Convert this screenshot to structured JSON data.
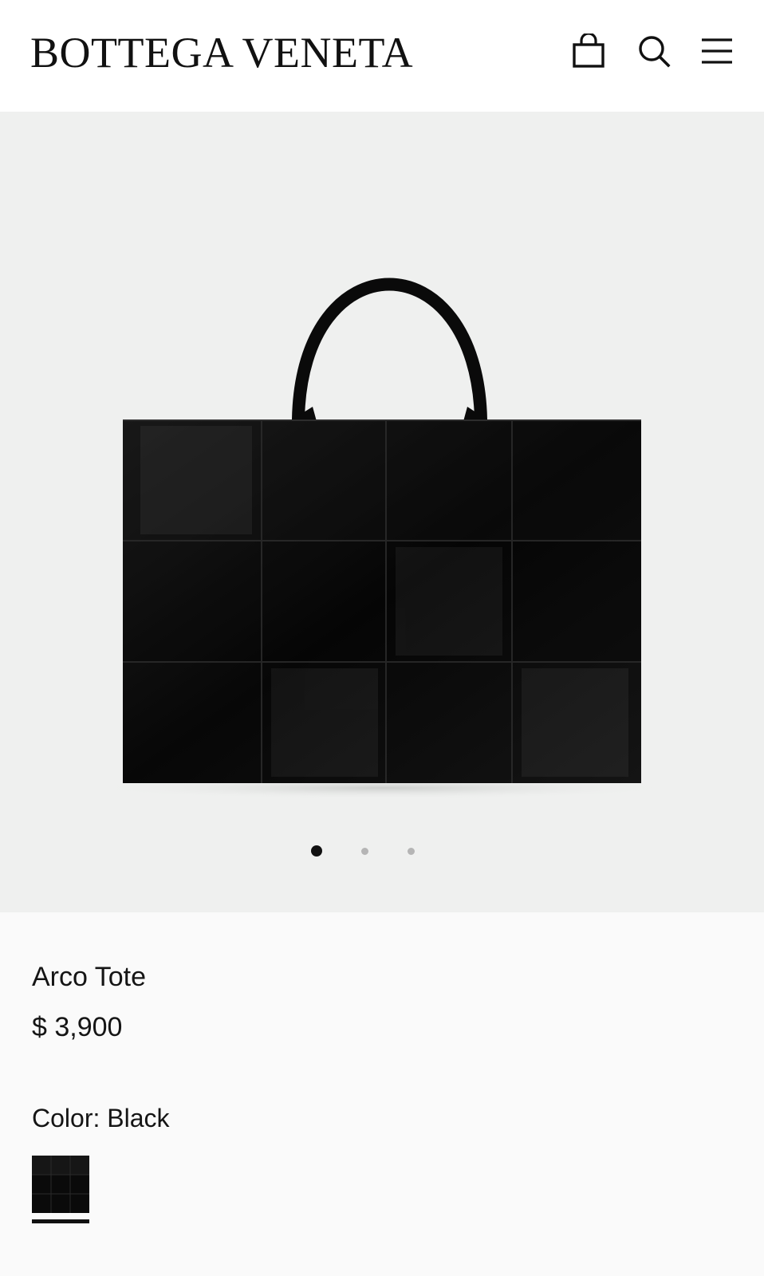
{
  "header": {
    "brand": "BOTTEGA VENETA",
    "icons": [
      "shopping-bag-icon",
      "search-icon",
      "menu-icon"
    ]
  },
  "gallery": {
    "image_count": 3,
    "active_index": 0
  },
  "product": {
    "name": "Arco Tote",
    "price": "$ 3,900",
    "color_label": "Color:",
    "color_value": "Black",
    "swatches": [
      {
        "name": "Black",
        "selected": true
      }
    ]
  },
  "colors": {
    "background": "#ffffff",
    "gallery_bg": "#eff0ef",
    "info_bg": "#fafafa",
    "text": "#151515",
    "dot_active": "#111111",
    "dot_inactive": "#b5b5b5",
    "bag": "#0b0b0b"
  }
}
